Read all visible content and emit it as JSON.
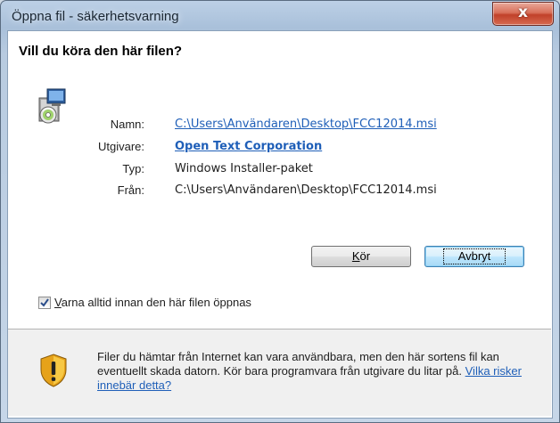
{
  "window": {
    "title": "Öppna fil - säkerhetsvarning",
    "close_glyph": "x"
  },
  "dialog": {
    "question": "Vill du köra den här filen?",
    "fields": [
      {
        "label": "Namn:",
        "value": "C:\\Users\\Användaren\\Desktop\\FCC12014.msi",
        "style": "link"
      },
      {
        "label": "Utgivare:",
        "value": "Open Text Corporation",
        "style": "link-bold"
      },
      {
        "label": "Typ:",
        "value": "Windows Installer-paket",
        "style": "plain"
      },
      {
        "label": "Från:",
        "value": "C:\\Users\\Användaren\\Desktop\\FCC12014.msi",
        "style": "plain"
      }
    ],
    "buttons": {
      "run_mnemonic": "K",
      "run_rest": "ör",
      "cancel": "Avbryt"
    },
    "checkbox": {
      "checked": true,
      "mnemonic": "V",
      "label_rest": "arna alltid innan den här filen öppnas"
    },
    "warning": {
      "text": "Filer du hämtar från Internet kan vara användbara, men den här sortens fil kan eventuellt skada datorn. Kör bara programvara från utgivare du litar på. ",
      "link": "Vilka risker innebär detta?"
    }
  },
  "colors": {
    "link": "#1f5fb8",
    "close_button": "#c1412a",
    "title_bar": "#a9c0da"
  },
  "icons": {
    "app": "installer-package-icon",
    "warning": "security-shield-icon",
    "check": "checkmark-icon"
  }
}
